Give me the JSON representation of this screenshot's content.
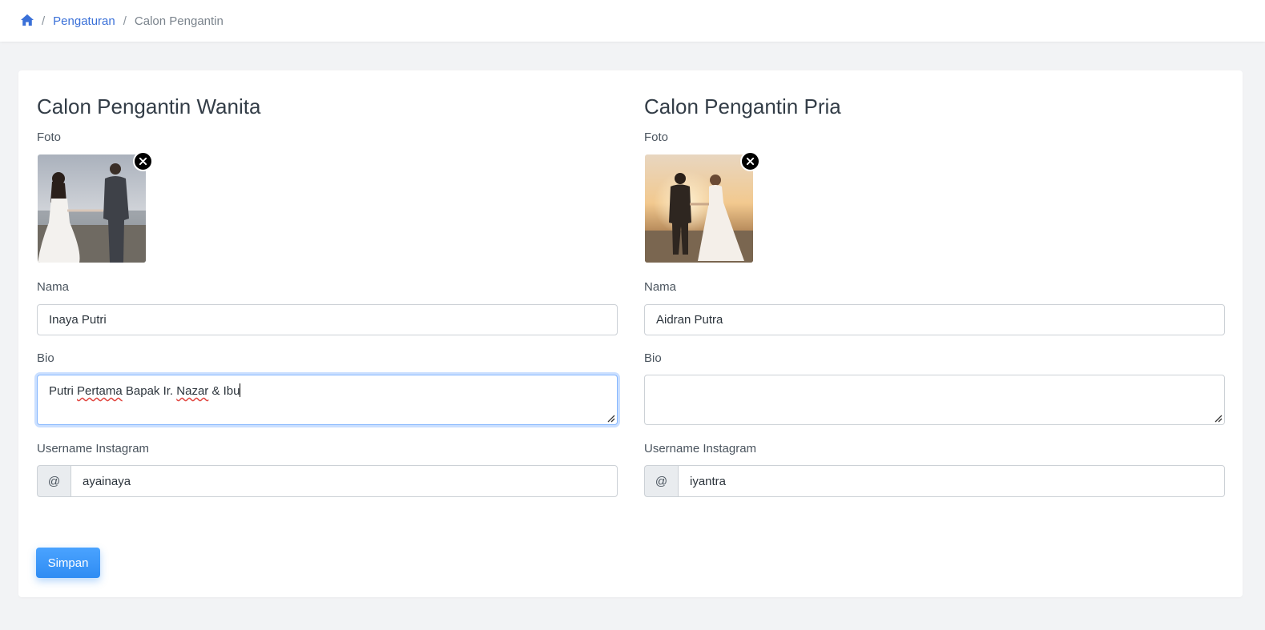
{
  "breadcrumb": {
    "home_icon": "home-icon",
    "separator": "/",
    "link": "Pengaturan",
    "current": "Calon Pengantin"
  },
  "bride": {
    "heading": "Calon Pengantin Wanita",
    "photo_label": "Foto",
    "name_label": "Nama",
    "name_value": "Inaya Putri",
    "bio_label": "Bio",
    "bio_parts": [
      "Putri ",
      "Pertama",
      " Bapak Ir. ",
      "Nazar",
      " & Ibu"
    ],
    "instagram_label": "Username Instagram",
    "instagram_prefix": "@",
    "instagram_value": "ayainaya"
  },
  "groom": {
    "heading": "Calon Pengantin Pria",
    "photo_label": "Foto",
    "name_label": "Nama",
    "name_value": "Aidran Putra",
    "bio_label": "Bio",
    "bio_value": "",
    "instagram_label": "Username Instagram",
    "instagram_prefix": "@",
    "instagram_value": "iyantra"
  },
  "actions": {
    "save_label": "Simpan"
  },
  "colors": {
    "accent": "#3a70d8",
    "button": "#3a94f7",
    "focus": "#86b7fe"
  }
}
